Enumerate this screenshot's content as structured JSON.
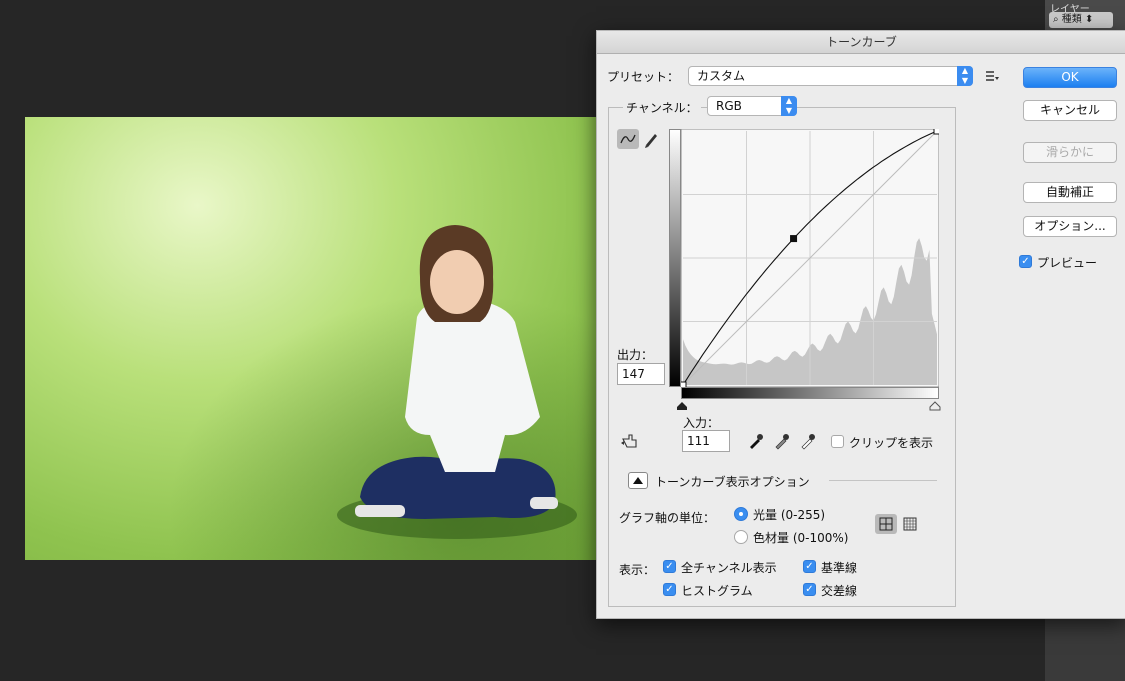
{
  "ps_panel": {
    "tab_label": "レイヤー",
    "filter_label": "種類"
  },
  "dialog": {
    "title": "トーンカーブ",
    "preset": {
      "label": "プリセット：",
      "value": "カスタム"
    },
    "channel": {
      "label": "チャンネル：",
      "value": "RGB"
    },
    "output": {
      "label": "出力：",
      "value": "147"
    },
    "input": {
      "label": "入力：",
      "value": "111"
    },
    "clip_label": "クリップを表示",
    "display_options_label": "トーンカーブ表示オプション",
    "axis_units_label": "グラフ軸の単位：",
    "radio_light": "光量 (0-255)",
    "radio_pigment": "色材量 (0-100%)",
    "show_label": "表示：",
    "cb_all_channels": "全チャンネル表示",
    "cb_baseline": "基準線",
    "cb_histogram": "ヒストグラム",
    "cb_intersection": "交差線",
    "buttons": {
      "ok": "OK",
      "cancel": "キャンセル",
      "smooth": "滑らかに",
      "auto": "自動補正",
      "options": "オプション..."
    },
    "preview_label": "プレビュー"
  },
  "colors": {
    "accent": "#3a8ef0",
    "dialog_bg": "#ececec",
    "canvas_bg": "#262626"
  },
  "chart_data": {
    "type": "line",
    "x": [
      0,
      111,
      255
    ],
    "y": [
      0,
      147,
      255
    ],
    "xlim": [
      0,
      255
    ],
    "ylim": [
      0,
      255
    ],
    "grid": "4x4",
    "histogram": true
  }
}
